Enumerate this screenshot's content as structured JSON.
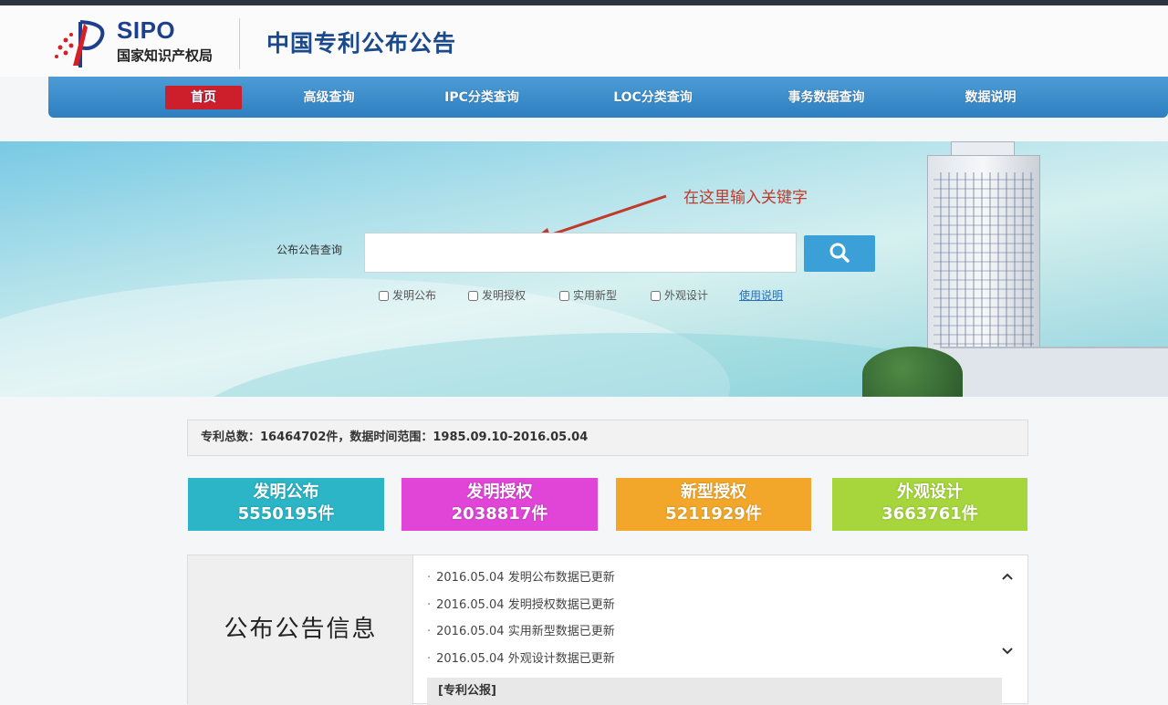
{
  "header": {
    "logo_sipo": "SIPO",
    "logo_cn": "国家知识产权局",
    "site_title": "中国专利公布公告"
  },
  "nav": {
    "items": [
      {
        "label": "首页",
        "active": true
      },
      {
        "label": "高级查询"
      },
      {
        "label": "IPC分类查询"
      },
      {
        "label": "LOC分类查询"
      },
      {
        "label": "事务数据查询"
      },
      {
        "label": "数据说明"
      }
    ]
  },
  "search": {
    "label": "公布公告查询",
    "value": "",
    "placeholder": "",
    "button_icon": "search-icon",
    "annotation": "在这里输入关键字",
    "checkboxes": [
      "发明公布",
      "发明授权",
      "实用新型",
      "外观设计"
    ],
    "help_link": "使用说明"
  },
  "stats": {
    "text": "专利总数：16464702件，数据时间范围：1985.09.10-2016.05.04"
  },
  "tiles": [
    {
      "name": "发明公布",
      "count": "5550195件",
      "color": "#2bb5c6"
    },
    {
      "name": "发明授权",
      "count": "2038817件",
      "color": "#e045d8"
    },
    {
      "name": "新型授权",
      "count": "5211929件",
      "color": "#f2a72a"
    },
    {
      "name": "外观设计",
      "count": "3663761件",
      "color": "#a6d63c"
    }
  ],
  "info": {
    "title": "公布公告信息",
    "news": [
      "2016.05.04 发明公布数据已更新",
      "2016.05.04 发明授权数据已更新",
      "2016.05.04 实用新型数据已更新",
      "2016.05.04 外观设计数据已更新"
    ],
    "subhead": "[专利公报]"
  }
}
